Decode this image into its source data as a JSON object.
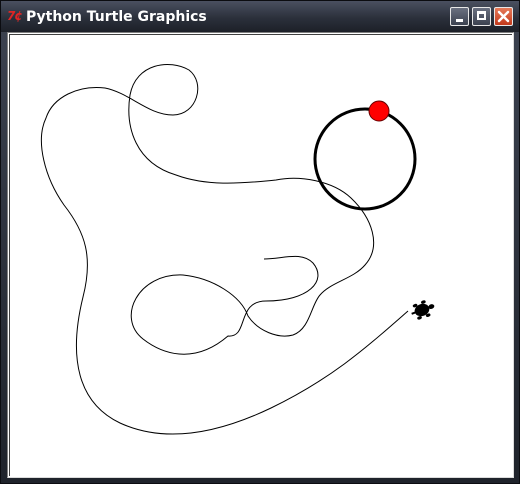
{
  "window": {
    "title": "Python Turtle Graphics",
    "icon_text": "7¢",
    "icon_name": "tk-feather-icon",
    "controls": [
      "minimize-icon",
      "maximize-icon",
      "close-icon"
    ]
  },
  "canvas": {
    "background": "#ffffff",
    "pen_color": "#000000",
    "dot_color": "#ff0000",
    "turtle_shape": "turtle"
  }
}
